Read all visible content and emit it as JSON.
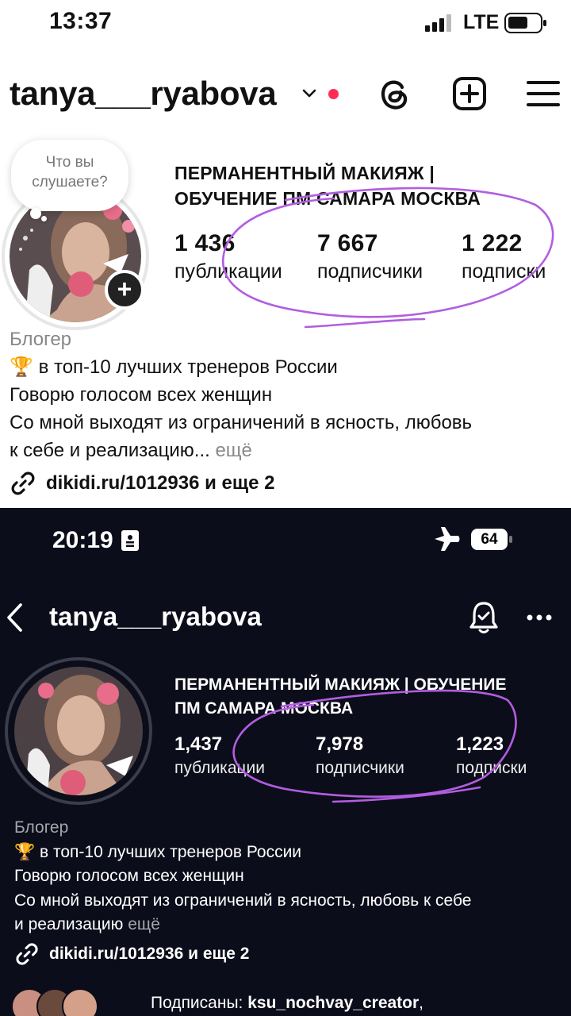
{
  "top": {
    "status": {
      "time": "13:37",
      "network": "LTE"
    },
    "header": {
      "username": "tanya___ryabova"
    },
    "story_prompt": [
      "Что вы",
      "слушаете?"
    ],
    "profile_name_lines": [
      "ПЕРМАНЕНТНЫЙ МАКИЯЖ |",
      "ОБУЧЕНИЕ ПМ САМАРА МОСКВА"
    ],
    "stats": [
      {
        "value": "1 436",
        "label": "публикации"
      },
      {
        "value": "7 667",
        "label": "подписчики"
      },
      {
        "value": "1 222",
        "label": "подписки"
      }
    ],
    "bio": {
      "category": "Блогер",
      "line1": "в топ-10 лучших тренеров России",
      "line2": "Говорю голосом всех женщин",
      "line3": "Со мной выходят из ограничений в ясность, любовь",
      "line4": "к себе и реализацию...",
      "more": "ещё"
    },
    "link": "dikidi.ru/1012936 и еще 2",
    "icons": [
      "signal-icon",
      "battery-icon",
      "chevron-down-icon",
      "threads-icon",
      "add-post-icon",
      "menu-icon",
      "add-story-icon",
      "link-icon",
      "trophy-icon"
    ]
  },
  "bottom": {
    "status": {
      "time": "20:19",
      "battery": "64"
    },
    "header": {
      "username": "tanya___ryabova"
    },
    "profile_name_lines": [
      "ПЕРМАНЕНТНЫЙ МАКИЯЖ | ОБУЧЕНИЕ",
      "ПМ САМАРА МОСКВА"
    ],
    "stats": [
      {
        "value": "1,437",
        "label": "публикации"
      },
      {
        "value": "7,978",
        "label": "подписчики"
      },
      {
        "value": "1,223",
        "label": "подписки"
      }
    ],
    "bio": {
      "category": "Блогер",
      "line1": "в топ-10 лучших тренеров России",
      "line2": "Говорю голосом всех женщин",
      "line3": "Со мной выходят из ограничений в ясность, любовь к себе",
      "line4": "и реализацию",
      "more": "ещё"
    },
    "link": "dikidi.ru/1012936 и еще 2",
    "followed_by": {
      "prefix": "Подписаны: ",
      "name": "ksu_nochvay_creator",
      "suffix": ","
    },
    "icons": [
      "id-card-icon",
      "airplane-icon",
      "battery-icon",
      "back-icon",
      "bell-icon",
      "more-icon",
      "link-icon",
      "trophy-icon"
    ]
  },
  "colors": {
    "annotation": "#b15ee0",
    "dark_bg": "#0c0d1a",
    "notification_dot": "#ff2d55"
  }
}
